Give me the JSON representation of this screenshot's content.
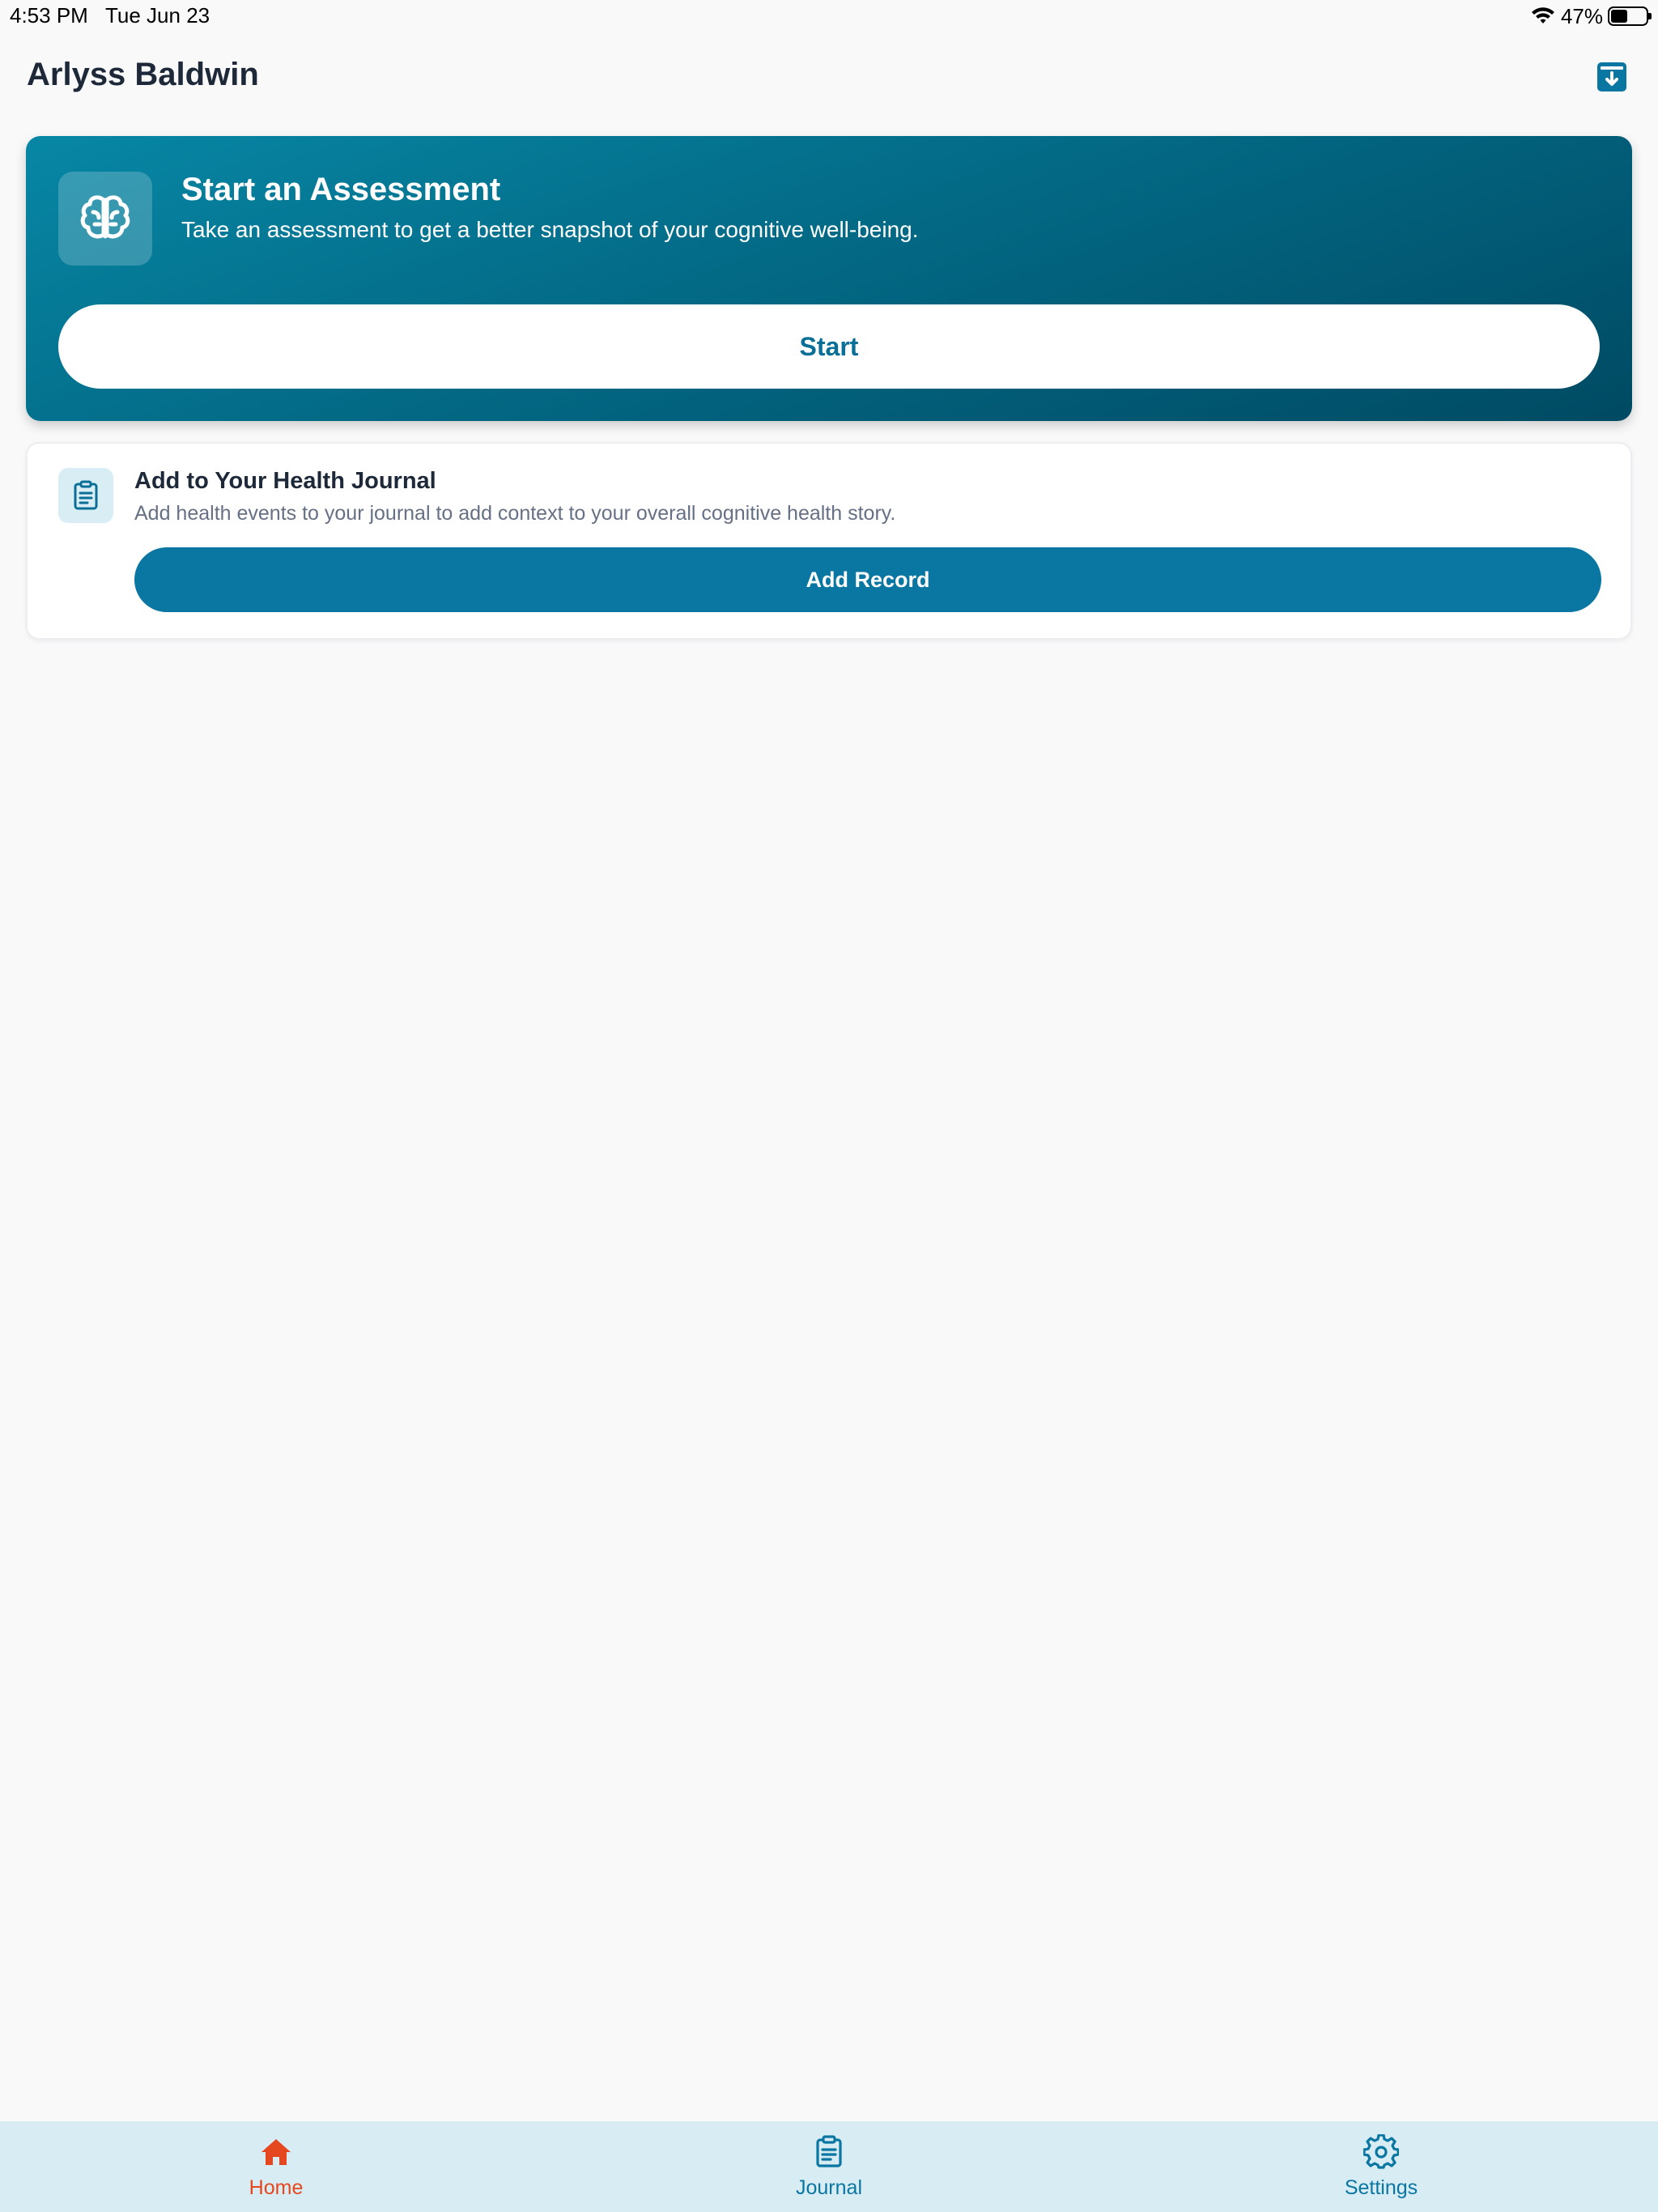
{
  "status_bar": {
    "time": "4:53 PM",
    "date": "Tue Jun 23",
    "battery_percent": "47%",
    "battery_level": 0.47,
    "wifi_icon": "wifi-icon"
  },
  "header": {
    "title": "Arlyss Baldwin",
    "archive_icon": "archive-download-icon"
  },
  "assessment_card": {
    "icon": "brain-icon",
    "title": "Start an Assessment",
    "description": "Take an assessment to get a better snapshot of your cognitive well-being.",
    "button_label": "Start"
  },
  "journal_card": {
    "icon": "clipboard-icon",
    "title": "Add to Your Health Journal",
    "description": "Add health events to your journal to add context to your overall cognitive health story.",
    "button_label": "Add Record"
  },
  "tab_bar": {
    "tabs": [
      {
        "label": "Home",
        "icon": "home-icon",
        "active": true
      },
      {
        "label": "Journal",
        "icon": "clipboard-icon",
        "active": false
      },
      {
        "label": "Settings",
        "icon": "gear-icon",
        "active": false
      }
    ]
  },
  "colors": {
    "primary": "#0a76a2",
    "active_tab": "#e5471f",
    "inactive_tab": "#0a76a2",
    "tab_bar_bg": "#d8ecf4",
    "background": "#f9f9fa"
  }
}
